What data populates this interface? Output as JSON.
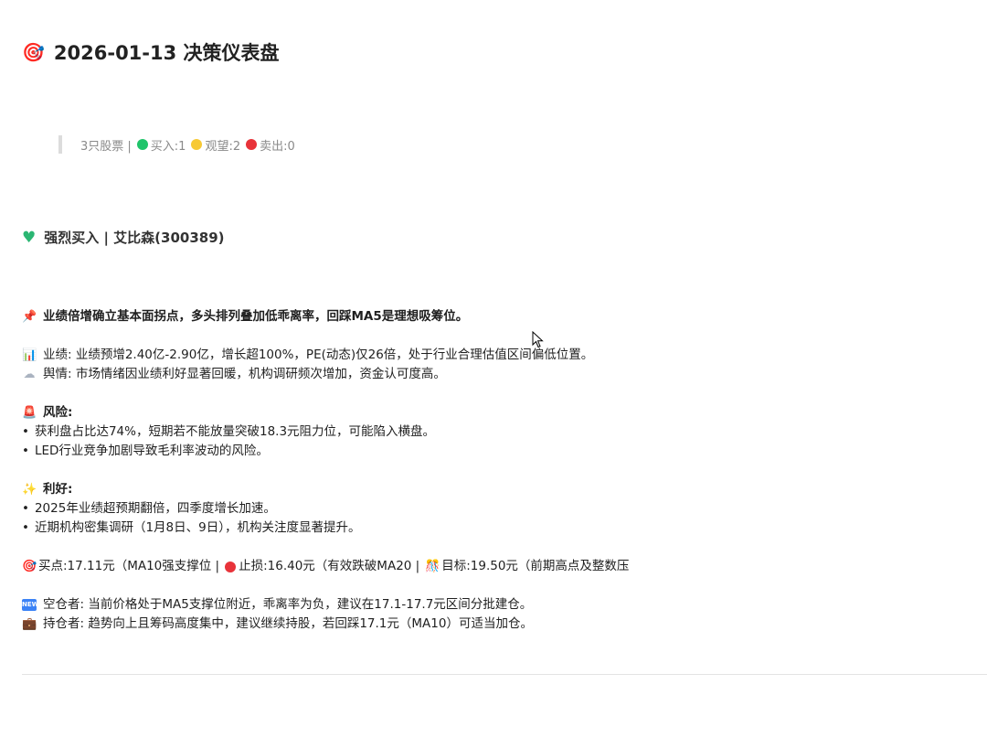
{
  "header": {
    "icon": "target-icon",
    "title": "2026-01-13 决策仪表盘"
  },
  "summary": {
    "count_text": "3只股票 |",
    "buy_label": "买入:1",
    "watch_label": "观望:2",
    "sell_label": "卖出:0",
    "colors": {
      "buy": "#1fc46a",
      "watch": "#f7c934",
      "sell": "#e8333a"
    }
  },
  "stock": {
    "heading": "强烈买入 | 艾比森(300389)",
    "heading_icon": "green-heart-icon",
    "headline_icon": "pushpin-icon",
    "headline": "业绩倍增确立基本面拐点，多头排列叠加低乖离率，回踩MA5是理想吸筹位。",
    "performance": "业绩: 业绩预增2.40亿-2.90亿，增长超100%，PE(动态)仅26倍，处于行业合理估值区间偏低位置。",
    "sentiment": "舆情: 市场情绪因业绩利好显著回暖，机构调研频次增加，资金认可度高。",
    "risk_title": "风险:",
    "risks": [
      "获利盘占比达74%，短期若不能放量突破18.3元阻力位，可能陷入横盘。",
      "LED行业竞争加剧导致毛利率波动的风险。"
    ],
    "positive_title": "利好:",
    "positives": [
      "2025年业绩超预期翻倍，四季度增长加速。",
      "近期机构密集调研（1月8日、9日），机构关注度显著提升。"
    ],
    "buy_point": "买点:17.11元（MA10强支撑位 |",
    "stop_loss": "止损:16.40元（有效跌破MA20 |",
    "target": "目标:19.50元（前期高点及整数压",
    "empty_position": "空仓者: 当前价格处于MA5支撑位附近，乖离率为负，建议在17.1-17.7元区间分批建仓。",
    "holding_position": "持仓者: 趋势向上且筹码高度集中，建议继续持股，若回踩17.1元（MA10）可适当加仓。"
  }
}
